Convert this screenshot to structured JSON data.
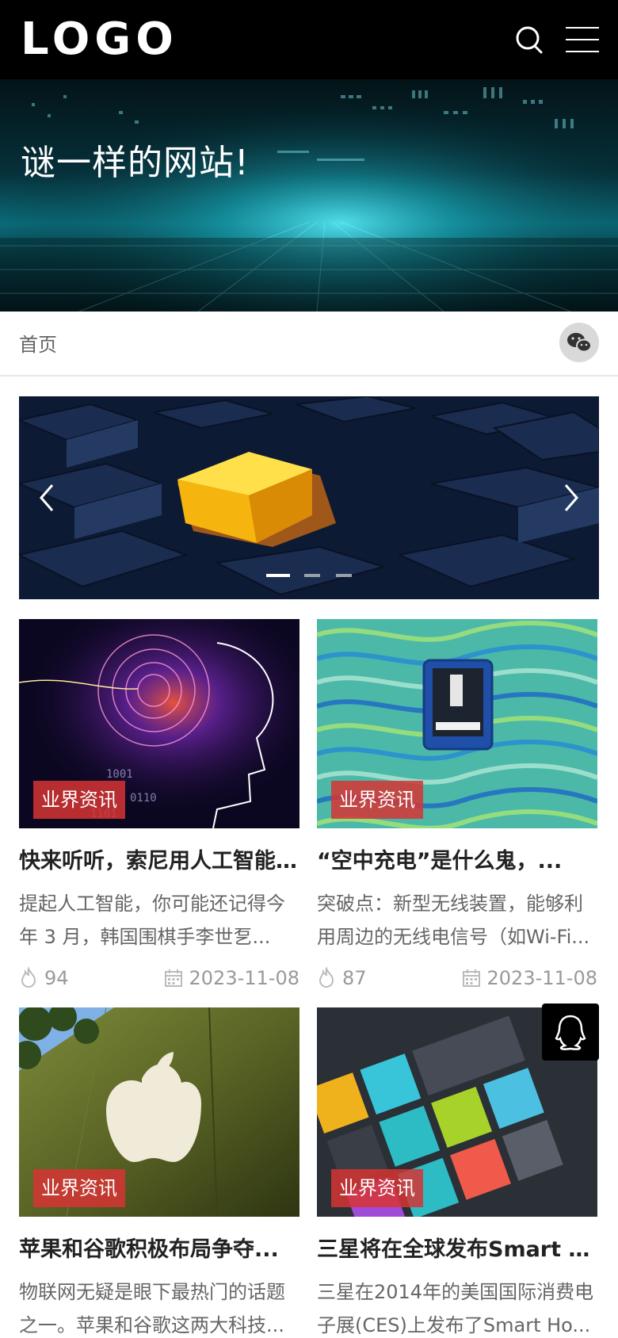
{
  "header": {
    "logo_text": "LOGO",
    "search_icon": "search-icon",
    "menu_icon": "menu-icon"
  },
  "hero": {
    "title": "谜一样的网站!"
  },
  "breadcrumb": {
    "home_label": "首页",
    "share_icon": "wechat-icon"
  },
  "slider": {
    "prev_icon": "chevron-left-icon",
    "next_icon": "chevron-right-icon",
    "slide_count": 3,
    "active_index": 0
  },
  "articles": [
    {
      "tag": "业界资讯",
      "title": "快来听听，索尼用人工智能...",
      "summary": "提起人工智能，你可能还记得今年 3 月，韩国围棋手李世乭...",
      "views": "94",
      "date": "2023-11-08"
    },
    {
      "tag": "业界资讯",
      "title": "“空中充电”是什么鬼，...",
      "summary": "突破点：新型无线装置，能够利用周边的无线电信号（如Wi-Fi...",
      "views": "87",
      "date": "2023-11-08"
    },
    {
      "tag": "业界资讯",
      "title": "苹果和谷歌积极布局争夺...",
      "summary": "物联网无疑是眼下最热门的话题之一。苹果和谷歌这两大科技...",
      "views": "",
      "date": ""
    },
    {
      "tag": "业界资讯",
      "title": "三星将在全球发布Smart Ho...",
      "summary": "三星在2014年的美国国际消费电子展(CES)上发布了Smart Ho...",
      "views": "",
      "date": ""
    }
  ],
  "float": {
    "qq_icon": "qq-icon"
  },
  "colors": {
    "header_bg": "#000000",
    "tag_bg": "#d63434",
    "text_muted": "#999999"
  }
}
